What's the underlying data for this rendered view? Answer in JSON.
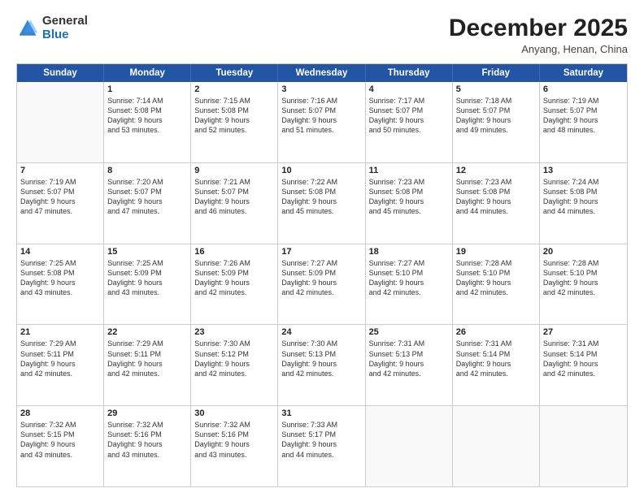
{
  "logo": {
    "general": "General",
    "blue": "Blue"
  },
  "title": "December 2025",
  "location": "Anyang, Henan, China",
  "days_of_week": [
    "Sunday",
    "Monday",
    "Tuesday",
    "Wednesday",
    "Thursday",
    "Friday",
    "Saturday"
  ],
  "weeks": [
    [
      {
        "day": "",
        "info": ""
      },
      {
        "day": "1",
        "info": "Sunrise: 7:14 AM\nSunset: 5:08 PM\nDaylight: 9 hours\nand 53 minutes."
      },
      {
        "day": "2",
        "info": "Sunrise: 7:15 AM\nSunset: 5:08 PM\nDaylight: 9 hours\nand 52 minutes."
      },
      {
        "day": "3",
        "info": "Sunrise: 7:16 AM\nSunset: 5:07 PM\nDaylight: 9 hours\nand 51 minutes."
      },
      {
        "day": "4",
        "info": "Sunrise: 7:17 AM\nSunset: 5:07 PM\nDaylight: 9 hours\nand 50 minutes."
      },
      {
        "day": "5",
        "info": "Sunrise: 7:18 AM\nSunset: 5:07 PM\nDaylight: 9 hours\nand 49 minutes."
      },
      {
        "day": "6",
        "info": "Sunrise: 7:19 AM\nSunset: 5:07 PM\nDaylight: 9 hours\nand 48 minutes."
      }
    ],
    [
      {
        "day": "7",
        "info": "Sunrise: 7:19 AM\nSunset: 5:07 PM\nDaylight: 9 hours\nand 47 minutes."
      },
      {
        "day": "8",
        "info": "Sunrise: 7:20 AM\nSunset: 5:07 PM\nDaylight: 9 hours\nand 47 minutes."
      },
      {
        "day": "9",
        "info": "Sunrise: 7:21 AM\nSunset: 5:07 PM\nDaylight: 9 hours\nand 46 minutes."
      },
      {
        "day": "10",
        "info": "Sunrise: 7:22 AM\nSunset: 5:08 PM\nDaylight: 9 hours\nand 45 minutes."
      },
      {
        "day": "11",
        "info": "Sunrise: 7:23 AM\nSunset: 5:08 PM\nDaylight: 9 hours\nand 45 minutes."
      },
      {
        "day": "12",
        "info": "Sunrise: 7:23 AM\nSunset: 5:08 PM\nDaylight: 9 hours\nand 44 minutes."
      },
      {
        "day": "13",
        "info": "Sunrise: 7:24 AM\nSunset: 5:08 PM\nDaylight: 9 hours\nand 44 minutes."
      }
    ],
    [
      {
        "day": "14",
        "info": "Sunrise: 7:25 AM\nSunset: 5:08 PM\nDaylight: 9 hours\nand 43 minutes."
      },
      {
        "day": "15",
        "info": "Sunrise: 7:25 AM\nSunset: 5:09 PM\nDaylight: 9 hours\nand 43 minutes."
      },
      {
        "day": "16",
        "info": "Sunrise: 7:26 AM\nSunset: 5:09 PM\nDaylight: 9 hours\nand 42 minutes."
      },
      {
        "day": "17",
        "info": "Sunrise: 7:27 AM\nSunset: 5:09 PM\nDaylight: 9 hours\nand 42 minutes."
      },
      {
        "day": "18",
        "info": "Sunrise: 7:27 AM\nSunset: 5:10 PM\nDaylight: 9 hours\nand 42 minutes."
      },
      {
        "day": "19",
        "info": "Sunrise: 7:28 AM\nSunset: 5:10 PM\nDaylight: 9 hours\nand 42 minutes."
      },
      {
        "day": "20",
        "info": "Sunrise: 7:28 AM\nSunset: 5:10 PM\nDaylight: 9 hours\nand 42 minutes."
      }
    ],
    [
      {
        "day": "21",
        "info": "Sunrise: 7:29 AM\nSunset: 5:11 PM\nDaylight: 9 hours\nand 42 minutes."
      },
      {
        "day": "22",
        "info": "Sunrise: 7:29 AM\nSunset: 5:11 PM\nDaylight: 9 hours\nand 42 minutes."
      },
      {
        "day": "23",
        "info": "Sunrise: 7:30 AM\nSunset: 5:12 PM\nDaylight: 9 hours\nand 42 minutes."
      },
      {
        "day": "24",
        "info": "Sunrise: 7:30 AM\nSunset: 5:13 PM\nDaylight: 9 hours\nand 42 minutes."
      },
      {
        "day": "25",
        "info": "Sunrise: 7:31 AM\nSunset: 5:13 PM\nDaylight: 9 hours\nand 42 minutes."
      },
      {
        "day": "26",
        "info": "Sunrise: 7:31 AM\nSunset: 5:14 PM\nDaylight: 9 hours\nand 42 minutes."
      },
      {
        "day": "27",
        "info": "Sunrise: 7:31 AM\nSunset: 5:14 PM\nDaylight: 9 hours\nand 42 minutes."
      }
    ],
    [
      {
        "day": "28",
        "info": "Sunrise: 7:32 AM\nSunset: 5:15 PM\nDaylight: 9 hours\nand 43 minutes."
      },
      {
        "day": "29",
        "info": "Sunrise: 7:32 AM\nSunset: 5:16 PM\nDaylight: 9 hours\nand 43 minutes."
      },
      {
        "day": "30",
        "info": "Sunrise: 7:32 AM\nSunset: 5:16 PM\nDaylight: 9 hours\nand 43 minutes."
      },
      {
        "day": "31",
        "info": "Sunrise: 7:33 AM\nSunset: 5:17 PM\nDaylight: 9 hours\nand 44 minutes."
      },
      {
        "day": "",
        "info": ""
      },
      {
        "day": "",
        "info": ""
      },
      {
        "day": "",
        "info": ""
      }
    ]
  ]
}
